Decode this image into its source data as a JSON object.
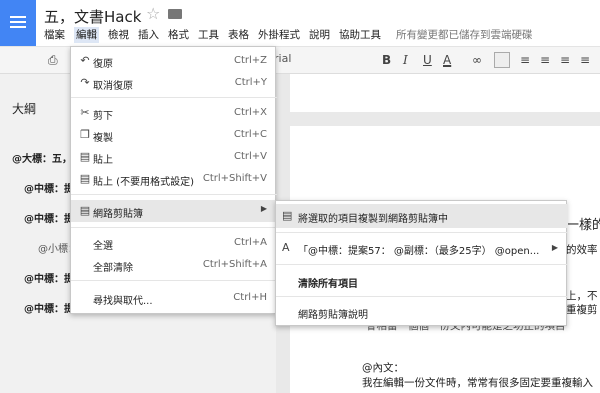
{
  "app": {
    "doc_title": "五，文書Hack",
    "saved_status": "所有變更都已儲存到雲端硬碟"
  },
  "menubar": [
    "檔案",
    "編輯",
    "檢視",
    "插入",
    "格式",
    "工具",
    "表格",
    "外掛程式",
    "說明",
    "協助工具"
  ],
  "toolbar": {
    "font_fragment": "rial",
    "text_color_letter": "A"
  },
  "outline": {
    "title": "大綱",
    "items": [
      "@大標：五，",
      "@中標：提",
      "@中標：提",
      "@小標：",
      "@中標：提",
      "@中標：提"
    ]
  },
  "document": {
    "fragments": [
      "一樣的",
      "的效率",
      "上，不",
      "重複剪",
      "的項目"
    ],
    "line_partial": "會相當一個個一份文內可能是之功止的項目",
    "content_label": "@內文：",
    "content_line": "我在編輯一份文件時，常常有很多固定要重複輸入"
  },
  "edit_menu": {
    "items": [
      {
        "icon": "undo-icon",
        "glyph": "↶",
        "label": "復原",
        "shortcut": "Ctrl+Z"
      },
      {
        "icon": "redo-icon",
        "glyph": "↷",
        "label": "取消復原",
        "shortcut": "Ctrl+Y"
      },
      {
        "icon": "cut-icon",
        "glyph": "✂",
        "label": "剪下",
        "shortcut": "Ctrl+X"
      },
      {
        "icon": "copy-icon",
        "glyph": "❐",
        "label": "複製",
        "shortcut": "Ctrl+C"
      },
      {
        "icon": "paste-icon",
        "glyph": "📋",
        "label": "貼上",
        "shortcut": "Ctrl+V"
      },
      {
        "icon": "paste-plain-icon",
        "glyph": "📋",
        "label": "貼上 (不要用格式設定)",
        "shortcut": "Ctrl+Shift+V"
      },
      {
        "icon": "web-clipboard-icon",
        "glyph": "📋",
        "label": "網路剪貼簿",
        "shortcut": ""
      },
      {
        "icon": "",
        "glyph": "",
        "label": "全選",
        "shortcut": "Ctrl+A"
      },
      {
        "icon": "",
        "glyph": "",
        "label": "全部清除",
        "shortcut": "Ctrl+Shift+A"
      },
      {
        "icon": "",
        "glyph": "",
        "label": "尋找與取代...",
        "shortcut": "Ctrl+H"
      }
    ],
    "submenu_arrow": "▶"
  },
  "clipboard_submenu": {
    "copy_selected": "將選取的項目複製到網路剪貼簿中",
    "entry_glyph": "A",
    "entry_text": "「@中標：提案57： @副標：（最多25字） @open...",
    "entry_arrow": "▶",
    "clear_all": "清除所有項目",
    "help": "網路剪貼簿說明"
  }
}
